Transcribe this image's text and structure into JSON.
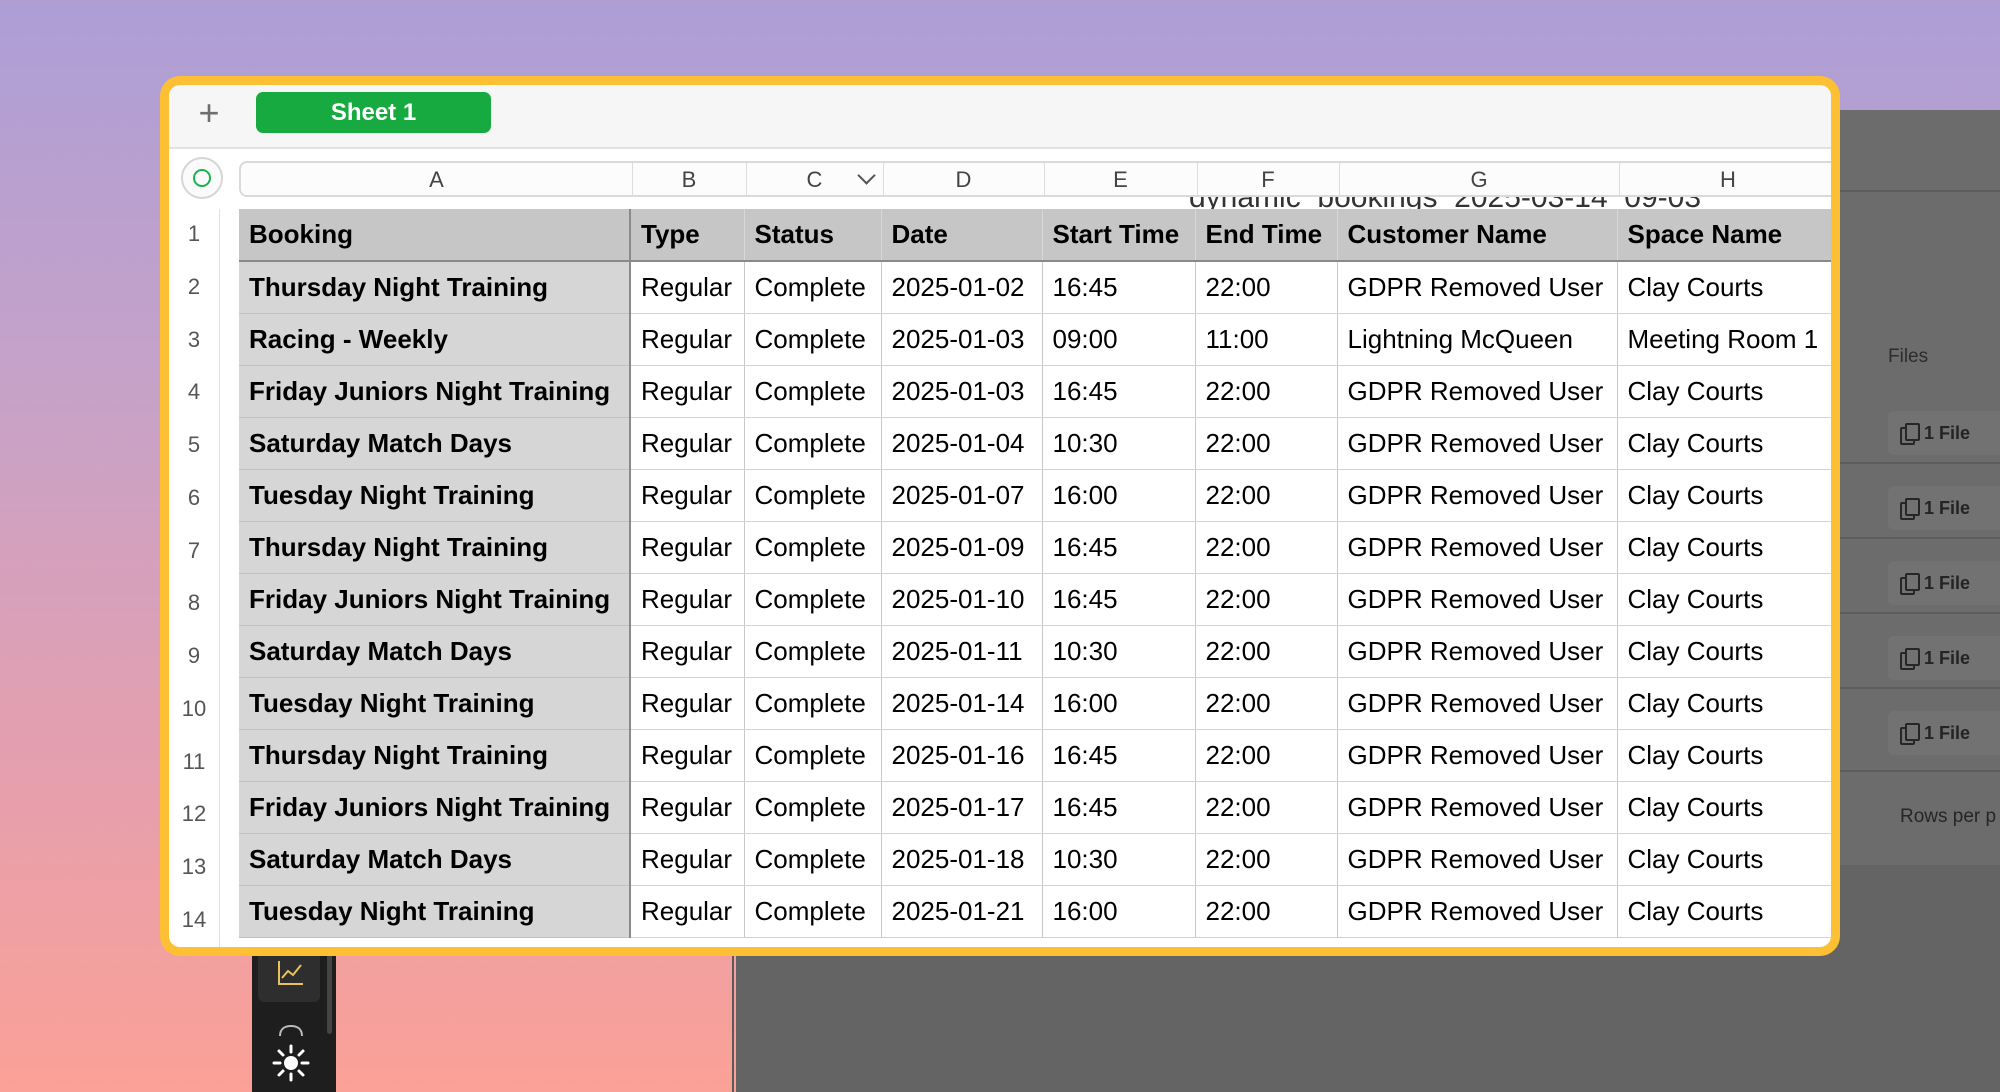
{
  "sheet": {
    "tabs": [
      {
        "label": "Sheet 1",
        "active": true
      }
    ],
    "add_icon": "plus-icon",
    "column_letters": [
      "A",
      "B",
      "C",
      "D",
      "E",
      "F",
      "G",
      "H"
    ],
    "row_numbers": [
      "1",
      "2",
      "3",
      "4",
      "5",
      "6",
      "7",
      "8",
      "9",
      "10",
      "11",
      "12",
      "13",
      "14"
    ],
    "header": [
      "Booking",
      "Type",
      "Status",
      "Date",
      "Start Time",
      "End Time",
      "Customer Name",
      "Space Name"
    ],
    "rows": [
      [
        "Thursday Night Training",
        "Regular",
        "Complete",
        "2025-01-02",
        "16:45",
        "22:00",
        "GDPR Removed User",
        "Clay Courts"
      ],
      [
        "Racing - Weekly",
        "Regular",
        "Complete",
        "2025-01-03",
        "09:00",
        "11:00",
        "Lightning McQueen",
        "Meeting Room 1"
      ],
      [
        "Friday Juniors  Night Training",
        "Regular",
        "Complete",
        "2025-01-03",
        "16:45",
        "22:00",
        "GDPR Removed User",
        "Clay Courts"
      ],
      [
        "Saturday Match Days",
        "Regular",
        "Complete",
        "2025-01-04",
        "10:30",
        "22:00",
        "GDPR Removed User",
        "Clay Courts"
      ],
      [
        "Tuesday Night Training",
        "Regular",
        "Complete",
        "2025-01-07",
        "16:00",
        "22:00",
        "GDPR Removed User",
        "Clay Courts"
      ],
      [
        "Thursday Night Training",
        "Regular",
        "Complete",
        "2025-01-09",
        "16:45",
        "22:00",
        "GDPR Removed User",
        "Clay Courts"
      ],
      [
        "Friday Juniors  Night Training",
        "Regular",
        "Complete",
        "2025-01-10",
        "16:45",
        "22:00",
        "GDPR Removed User",
        "Clay Courts"
      ],
      [
        "Saturday Match Days",
        "Regular",
        "Complete",
        "2025-01-11",
        "10:30",
        "22:00",
        "GDPR Removed User",
        "Clay Courts"
      ],
      [
        "Tuesday Night Training",
        "Regular",
        "Complete",
        "2025-01-14",
        "16:00",
        "22:00",
        "GDPR Removed User",
        "Clay Courts"
      ],
      [
        "Thursday Night Training",
        "Regular",
        "Complete",
        "2025-01-16",
        "16:45",
        "22:00",
        "GDPR Removed User",
        "Clay Courts"
      ],
      [
        "Friday Juniors  Night Training",
        "Regular",
        "Complete",
        "2025-01-17",
        "16:45",
        "22:00",
        "GDPR Removed User",
        "Clay Courts"
      ],
      [
        "Saturday Match Days",
        "Regular",
        "Complete",
        "2025-01-18",
        "10:30",
        "22:00",
        "GDPR Removed User",
        "Clay Courts"
      ],
      [
        "Tuesday Night Training",
        "Regular",
        "Complete",
        "2025-01-21",
        "16:00",
        "22:00",
        "GDPR Removed User",
        "Clay Courts"
      ]
    ]
  },
  "background_app": {
    "files_header": "Files",
    "file_chips": [
      "1 File",
      "1 File",
      "1 File",
      "1 File",
      "1 File"
    ],
    "rows_per_page_label": "Rows per p",
    "partial_title": "dynamic_bookings_2025-03-14_09-03"
  },
  "colors": {
    "window_border": "#fdbf33",
    "tab_active": "#16aa41",
    "header_fill": "#c6c6c6",
    "booking_fill": "#d6d6d6"
  }
}
